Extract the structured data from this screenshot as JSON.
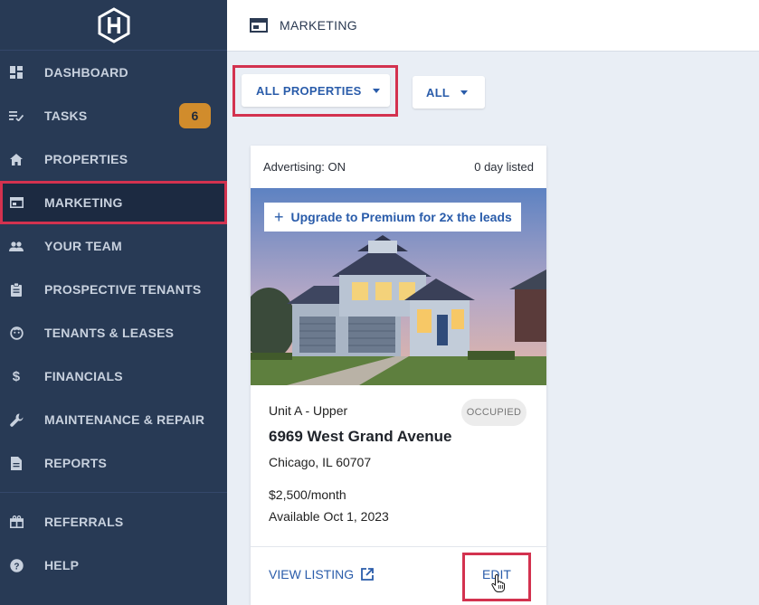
{
  "sidebar": {
    "items": [
      {
        "label": "DASHBOARD",
        "icon": "dashboard-icon"
      },
      {
        "label": "TASKS",
        "icon": "tasks-icon",
        "badge": "6"
      },
      {
        "label": "PROPERTIES",
        "icon": "home-icon"
      },
      {
        "label": "MARKETING",
        "icon": "marketing-icon",
        "active": true
      },
      {
        "label": "YOUR TEAM",
        "icon": "team-icon"
      },
      {
        "label": "PROSPECTIVE TENANTS",
        "icon": "clipboard-icon"
      },
      {
        "label": "TENANTS & LEASES",
        "icon": "tenant-icon"
      },
      {
        "label": "FINANCIALS",
        "icon": "dollar-icon"
      },
      {
        "label": "MAINTENANCE & REPAIR",
        "icon": "wrench-icon"
      },
      {
        "label": "REPORTS",
        "icon": "report-icon"
      },
      {
        "label": "REFERRALS",
        "icon": "gift-icon"
      },
      {
        "label": "HELP",
        "icon": "help-icon"
      }
    ]
  },
  "header": {
    "title": "MARKETING"
  },
  "filters": {
    "properties": "ALL PROPERTIES",
    "status": "ALL"
  },
  "card": {
    "advertising": "Advertising: ON",
    "listed": "0 day listed",
    "upgrade": "Upgrade to Premium for 2x the leads",
    "unit": "Unit A - Upper",
    "status": "OCCUPIED",
    "street": "6969 West Grand Avenue",
    "city": "Chicago, IL 60707",
    "price": "$2,500/month",
    "available": "Available Oct 1, 2023",
    "view_listing": "VIEW LISTING",
    "edit": "EDIT"
  },
  "colors": {
    "sidebar_bg": "#283a55",
    "accent_blue": "#2a5caa",
    "highlight_red": "#d3324f",
    "badge_orange": "#d18c2c"
  }
}
